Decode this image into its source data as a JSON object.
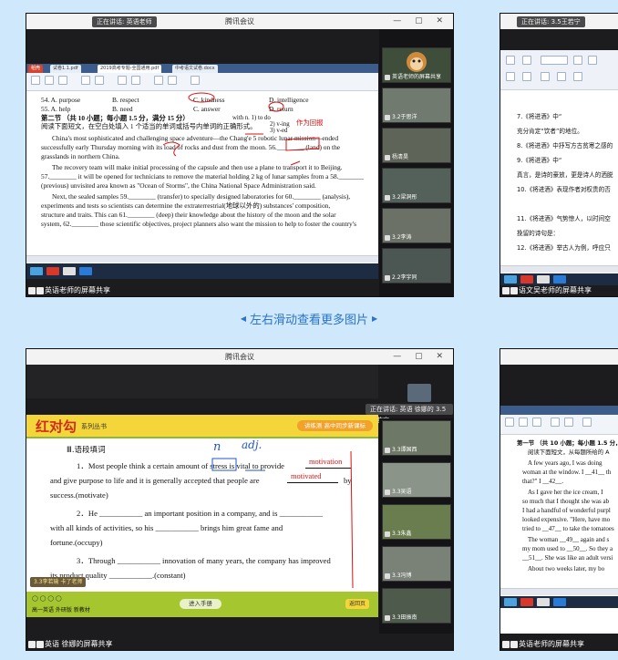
{
  "meeting_title": "腾讯会议",
  "window_controls": "— ▢ ✕",
  "panel1": {
    "speaker": "正在讲话: 英语老师",
    "share_label": "英语老师的屏幕共享",
    "tabs": [
      "稻壳",
      "试卷1.1.pdf",
      "2019高考专题-全国通用.pdf",
      "中考语文试卷.docx"
    ],
    "lines": [
      "54. A. purpose",
      "B. respect",
      "C. kindness",
      "D. intelligence",
      "55. A. help",
      "B. need",
      "C. answer",
      "D. return",
      "第二节 （共 10 小题；每小题 1.5 分，满分 15 分）",
      "阅读下面短文，在空白处填入 1 个适当的单词或括号内单词的正确形式。",
      "China's most sophisticated and challenging space adventure—the Chang'e 5 robotic lunar mission—ended",
      "successfully early Thursday morning with its load of rocks and dust from the moon. 56.________ (land) on the",
      "grasslands in northern China.",
      "The recovery team will make initial processing of the capsule and then use a plane to transport it to Beijing.",
      "57.________ it will be opened for technicians to remove the material holding 2 kg of lunar samples from a 58.________",
      "(previous) unvisited area known as \"Ocean of Storms\", the China National Space Administration said.",
      "Next, the sealed samples 59.________ (transfer) to specially designed laboratories for 60.________ (analysis),",
      "experiments and tests so scientists can determine the extraterrestrial(地球以外的) substances' composition,",
      "structure and traits. This can 61.________ (deep) their knowledge about the history of the moon and the solar",
      "system, 62.________ those scientific objectives, project planners also want the mission to help to foster the country's"
    ],
    "annotation_with": "with n. 1) to do",
    "annotation_ving": "2) v-ing",
    "annotation_ved": "3) v-ed",
    "annotation_red": "作为回报",
    "participants": [
      "英语老师的屏幕共享",
      "3.2于思洋",
      "杨清昊",
      "3.2梁洞彤",
      "3.2李涛",
      "2.2李宇同"
    ]
  },
  "panel2": {
    "speaker": "正在讲话: 3.5王若宁",
    "share_label": "语文吴老师的屏幕共享",
    "lines": [
      "7.《将进酒》中“",
      "充分肯定“饮者”的地位。",
      "8.《将进酒》中抒写方古贫寒之感的",
      "9.《将进酒》中“",
      "真言，是诗的豪放，更是诗人的洒脱",
      "10.《将进酒》表现作者对权贵的否",
      "11.《将进酒》气势惊人，以时间空",
      "挽留的诗句是：",
      "12.《将进酒》举古人为例，呼应只"
    ]
  },
  "nav_text": "左右滑动查看更多图片",
  "panel3": {
    "speaker": "正在讲话: 英语 徐娜的 3.5王若宁",
    "share_label": "英语 徐娜的屏幕共享",
    "brand": "红对勾",
    "series": "系列丛书",
    "banner": "讲练测 高中同步新课标",
    "section": "Ⅲ.语段填词",
    "lines": [
      "1．Most people think a certain amount of stress is vital to provide",
      "and give purpose to life and it is generally accepted that people are",
      "by",
      "success.(motivate)",
      "2．He ___________ an important position in a company, and is ___________",
      "with all kinds of activities, so his ___________ brings him great fame and",
      "fortune.(occupy)",
      "3．Through ___________ innovation of many years, the company has improved",
      "its product quality ___________.(constant)"
    ],
    "answer1": "motivation",
    "answer2": "motivated",
    "hw_n": "n",
    "hw_adj": "adj.",
    "bottom_left": "高一英语 外研版 新教材",
    "bottom_center": "进入手册",
    "bottom_right": "返回页",
    "toast": "3.3李若瑜 卡了老师",
    "participants": [
      "3.3谭国西",
      "3.3吴语",
      "3.3朱鑫",
      "3.3冯博",
      "3.3田振南"
    ]
  },
  "panel4": {
    "share_label": "英语老师的屏幕共享",
    "lines": [
      "第一节 （共 10 小题；每小题 1.5 分，满",
      "阅读下面短文，从每题所给的 A",
      "A few years ago, I was doing",
      "woman at the window. I __41__ th",
      "that?\" I __42__.",
      "As I gave her the ice cream, I",
      "so much that I thought she was ab",
      "I had a handful of wonderful purpl",
      "looked expensive. \"Here, have mo",
      "tried to __47__ to take the tomatoes",
      "The woman __49__ again and s",
      "my mom used to __50__. So they a",
      "__51__. She was like an adult versi",
      "About two weeks later, my bo"
    ]
  }
}
